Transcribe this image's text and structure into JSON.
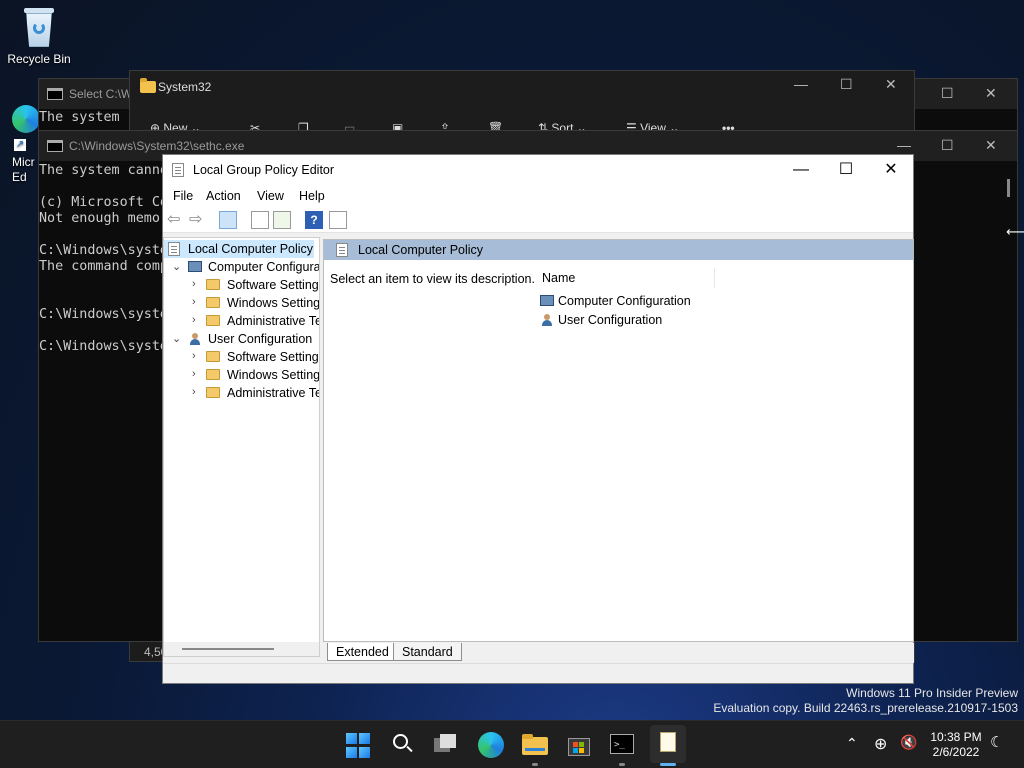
{
  "desktop": {
    "recycle_bin_label": "Recycle Bin",
    "edge_label_partial": "Micr\nEd"
  },
  "cmd_back": {
    "title": "Select C:\\W"
  },
  "explorer": {
    "title": "System32",
    "new_label": "New",
    "sort_label": "Sort",
    "view_label": "View",
    "more_label": "•••",
    "status_partial": "4,50"
  },
  "cmd_front": {
    "title": "C:\\Windows\\System32\\sethc.exe",
    "lines": [
      "The system canno",
      "",
      "(c) Microsoft Co",
      "Not enough memor",
      "",
      "C:\\Windows\\syste",
      "The command comp",
      "",
      "",
      "C:\\Windows\\syste",
      "",
      "C:\\Windows\\syste"
    ],
    "back_line": "The system"
  },
  "gpe": {
    "title": "Local Group Policy Editor",
    "menu": [
      "File",
      "Action",
      "View",
      "Help"
    ],
    "tree": {
      "root": "Local Computer Policy",
      "computer": "Computer Configura",
      "computer_children": [
        "Software Settings",
        "Windows Setting",
        "Administrative Te"
      ],
      "user": "User Configuration",
      "user_children": [
        "Software Settings",
        "Windows Setting",
        "Administrative Te"
      ]
    },
    "content": {
      "header": "Local Computer Policy",
      "description": "Select an item to view its description.",
      "column_name": "Name",
      "items": [
        "Computer Configuration",
        "User Configuration"
      ]
    },
    "tabs": [
      "Extended",
      "Standard"
    ]
  },
  "watermark": {
    "line1": "Windows 11 Pro Insider Preview",
    "line2": "Evaluation copy. Build 22463.rs_prerelease.210917-1503"
  },
  "taskbar": {
    "time": "10:38 PM",
    "date": "2/6/2022"
  }
}
